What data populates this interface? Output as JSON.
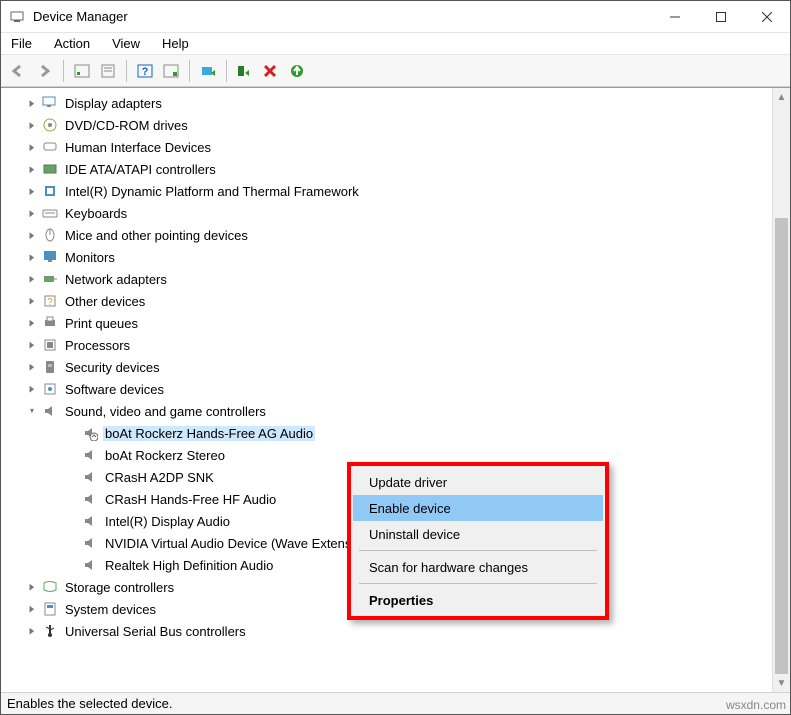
{
  "window": {
    "title": "Device Manager"
  },
  "menubar": [
    "File",
    "Action",
    "View",
    "Help"
  ],
  "status": "Enables the selected device.",
  "watermark": "wsxdn.com",
  "tree": [
    {
      "label": "Display adapters",
      "icon": "display",
      "expand": "closed",
      "level": 0
    },
    {
      "label": "DVD/CD-ROM drives",
      "icon": "disc",
      "expand": "closed",
      "level": 0
    },
    {
      "label": "Human Interface Devices",
      "icon": "hid",
      "expand": "closed",
      "level": 0
    },
    {
      "label": "IDE ATA/ATAPI controllers",
      "icon": "ide",
      "expand": "closed",
      "level": 0
    },
    {
      "label": "Intel(R) Dynamic Platform and Thermal Framework",
      "icon": "chip",
      "expand": "closed",
      "level": 0
    },
    {
      "label": "Keyboards",
      "icon": "keyboard",
      "expand": "closed",
      "level": 0
    },
    {
      "label": "Mice and other pointing devices",
      "icon": "mouse",
      "expand": "closed",
      "level": 0
    },
    {
      "label": "Monitors",
      "icon": "monitor",
      "expand": "closed",
      "level": 0
    },
    {
      "label": "Network adapters",
      "icon": "network",
      "expand": "closed",
      "level": 0
    },
    {
      "label": "Other devices",
      "icon": "other",
      "expand": "closed",
      "level": 0
    },
    {
      "label": "Print queues",
      "icon": "print",
      "expand": "closed",
      "level": 0
    },
    {
      "label": "Processors",
      "icon": "cpu",
      "expand": "closed",
      "level": 0
    },
    {
      "label": "Security devices",
      "icon": "security",
      "expand": "closed",
      "level": 0
    },
    {
      "label": "Software devices",
      "icon": "software",
      "expand": "closed",
      "level": 0
    },
    {
      "label": "Sound, video and game controllers",
      "icon": "sound",
      "expand": "open",
      "level": 0
    },
    {
      "label": "boAt Rockerz Hands-Free AG Audio",
      "icon": "speaker-dis",
      "expand": "none",
      "level": 1,
      "selected": true
    },
    {
      "label": "boAt Rockerz Stereo",
      "icon": "speaker",
      "expand": "none",
      "level": 1
    },
    {
      "label": "CRasH A2DP SNK",
      "icon": "speaker",
      "expand": "none",
      "level": 1
    },
    {
      "label": "CRasH Hands-Free HF Audio",
      "icon": "speaker",
      "expand": "none",
      "level": 1
    },
    {
      "label": "Intel(R) Display Audio",
      "icon": "speaker",
      "expand": "none",
      "level": 1
    },
    {
      "label": "NVIDIA Virtual Audio Device (Wave Extensible) (WDM)",
      "icon": "speaker",
      "expand": "none",
      "level": 1
    },
    {
      "label": "Realtek High Definition Audio",
      "icon": "speaker",
      "expand": "none",
      "level": 1
    },
    {
      "label": "Storage controllers",
      "icon": "storage",
      "expand": "closed",
      "level": 0
    },
    {
      "label": "System devices",
      "icon": "system",
      "expand": "closed",
      "level": 0
    },
    {
      "label": "Universal Serial Bus controllers",
      "icon": "usb",
      "expand": "closed",
      "level": 0
    }
  ],
  "context_menu": {
    "items": [
      {
        "label": "Update driver"
      },
      {
        "label": "Enable device",
        "selected": true
      },
      {
        "label": "Uninstall device"
      },
      {
        "sep": true
      },
      {
        "label": "Scan for hardware changes"
      },
      {
        "sep": true
      },
      {
        "label": "Properties",
        "bold": true
      }
    ]
  }
}
